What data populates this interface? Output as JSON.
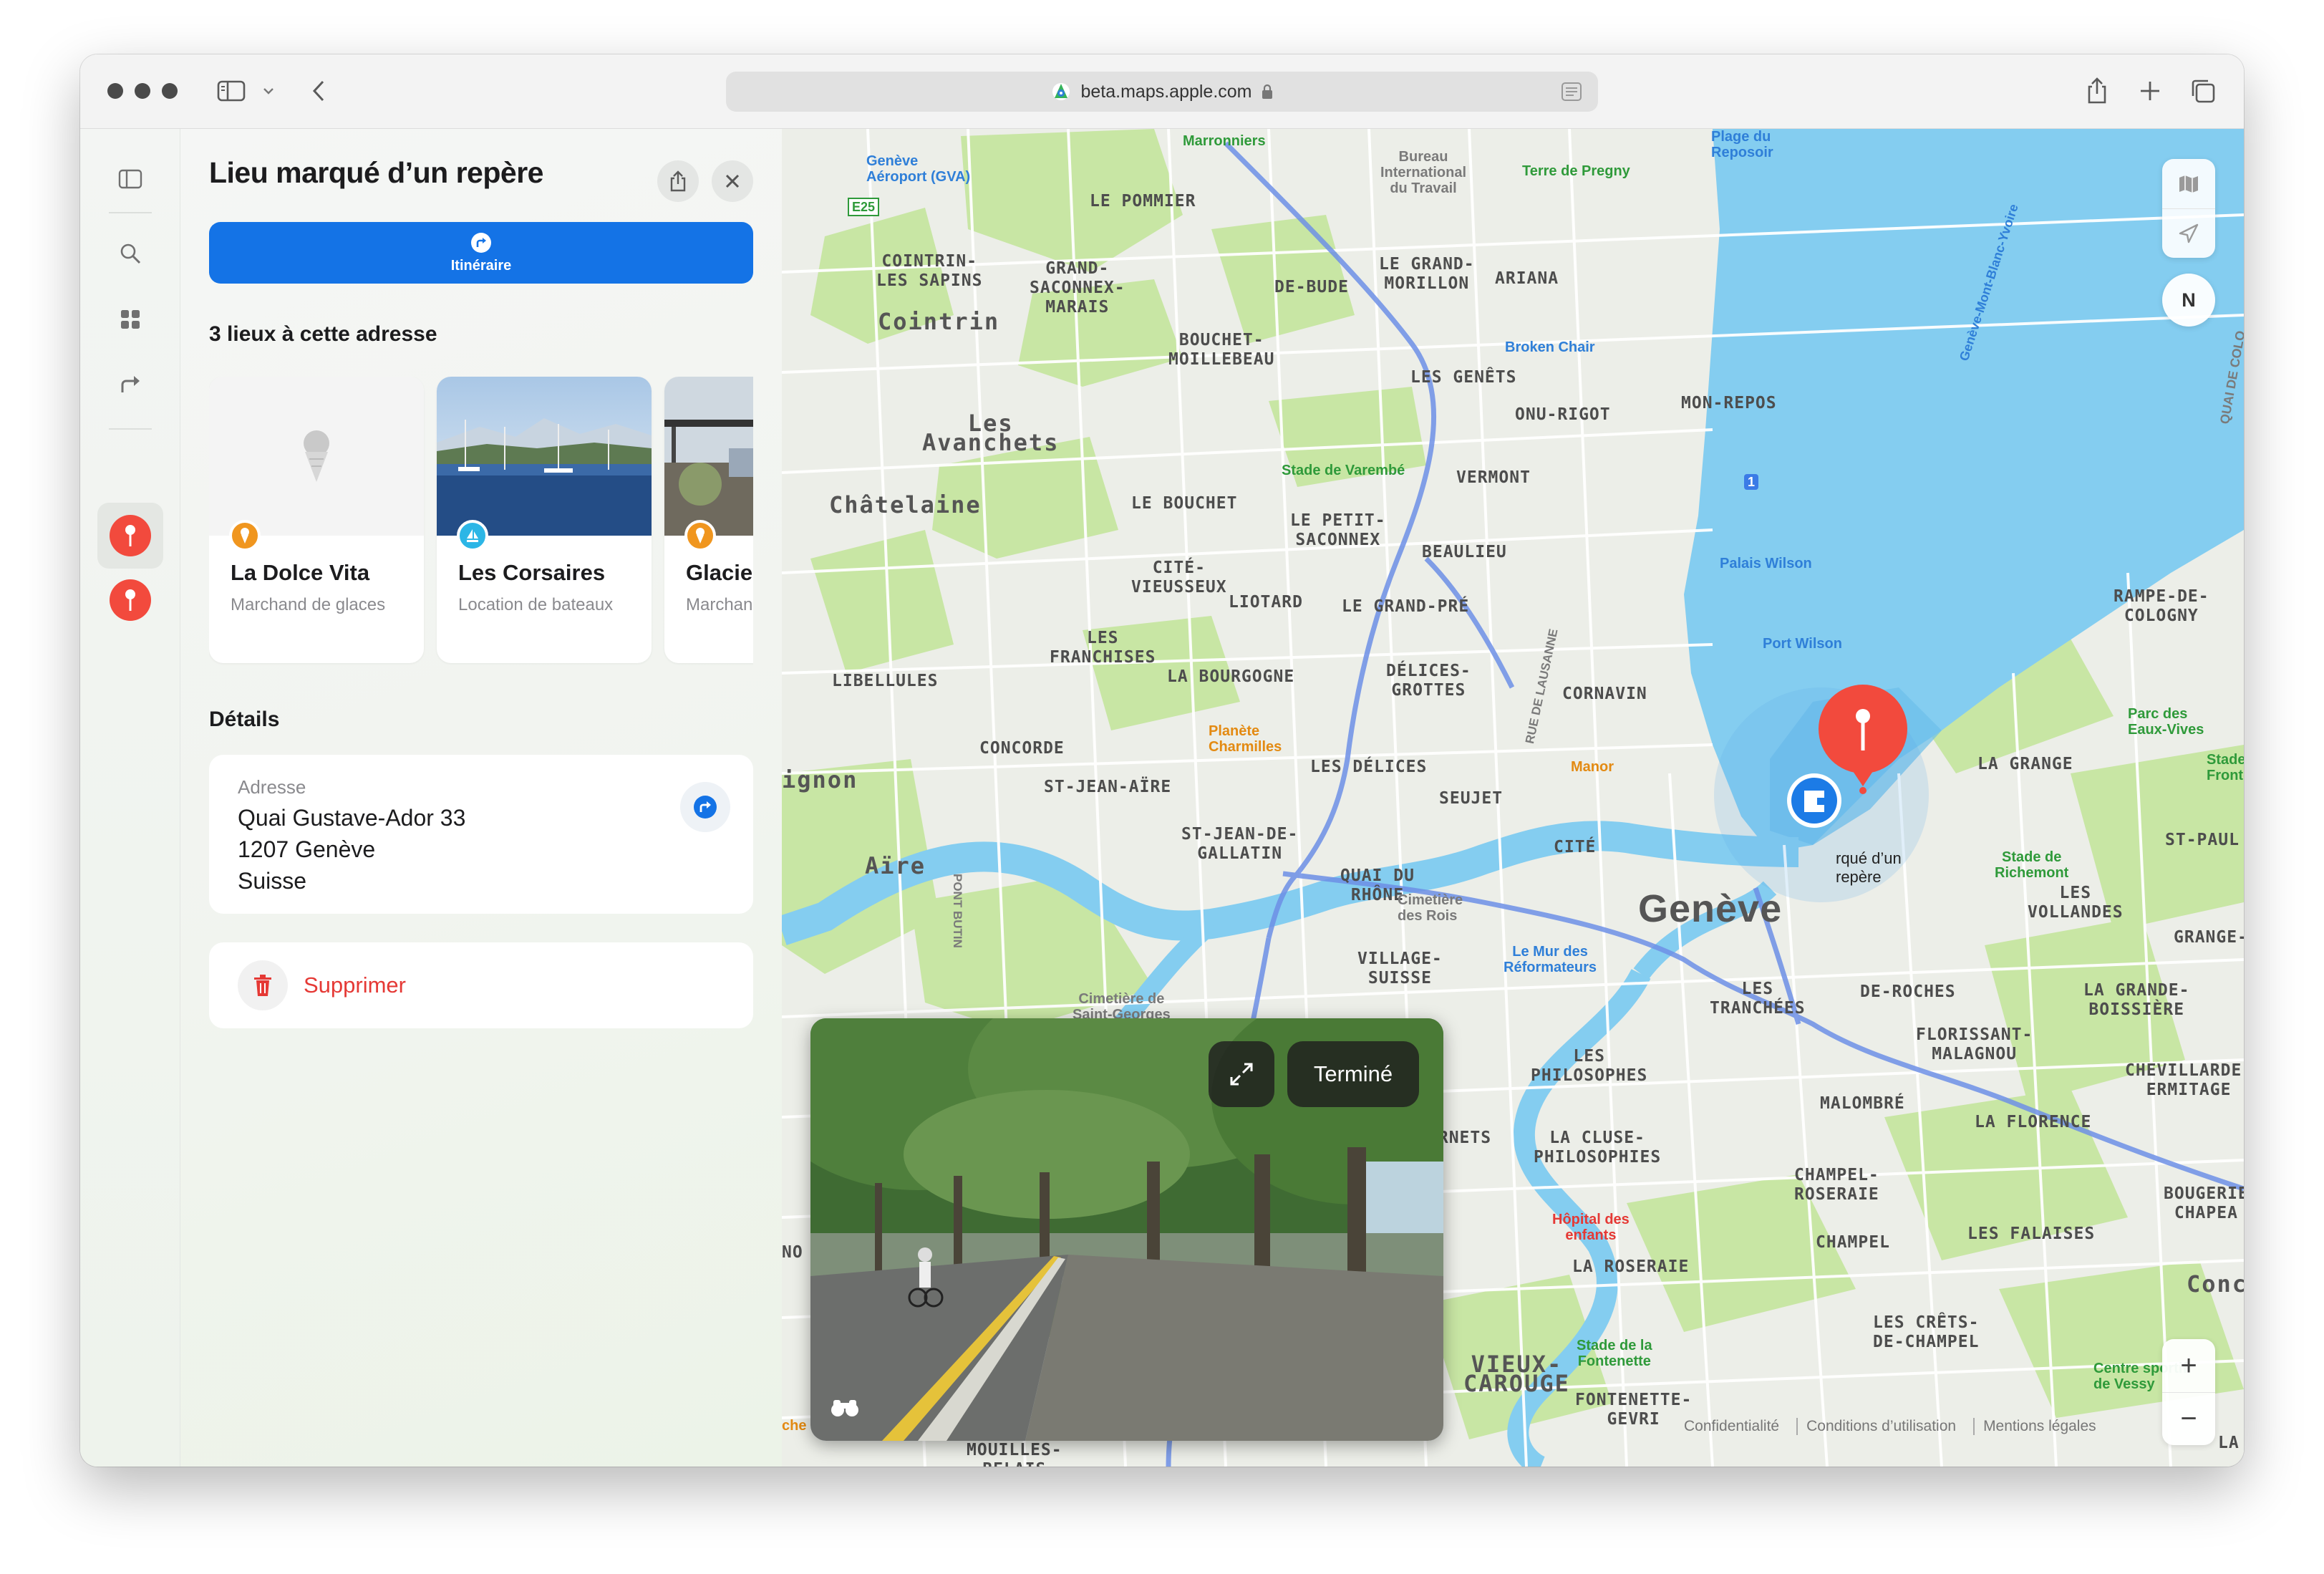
{
  "browser": {
    "url": "beta.maps.apple.com"
  },
  "panel": {
    "title": "Lieu marqué d’un repère",
    "route_label": "Itinéraire",
    "places_heading": "3 lieux à cette adresse",
    "places": [
      {
        "name": "La Dolce Vita",
        "type": "Marchand de glaces",
        "icon": "ice-cream-icon",
        "color": "#f0961f"
      },
      {
        "name": "Les Corsaires",
        "type": "Location de bateaux",
        "icon": "sailboat-icon",
        "color": "#2cb6e6"
      },
      {
        "name": "Glacie",
        "type": "Marchan glaces",
        "icon": "ice-cream-icon",
        "color": "#f0961f"
      }
    ],
    "details_heading": "Détails",
    "address_caption": "Adresse",
    "address_lines": [
      "Quai Gustave-Ador 33",
      "1207 Genève",
      "Suisse"
    ],
    "delete_label": "Supprimer"
  },
  "map": {
    "city": "Genève",
    "pin_label": "rqué d’un\nrepère",
    "compass": "N",
    "zoom_in": "+",
    "zoom_out": "−",
    "legal": [
      "Confidentialité",
      "Conditions d’utilisation",
      "Mentions légales"
    ],
    "districts": [
      "LE POMMIER",
      "COINTRIN-\nLES SAPINS",
      "GRAND-\nSACONNEX-\nMARAIS",
      "DE-BUDE",
      "LE GRAND-\nMORILLON",
      "ARIANA",
      "Cointrin",
      "BOUCHET-\nMOILLEBEAU",
      "LES GENÊTS",
      "ONU-RIGOT",
      "MON-REPOS",
      "Les\nAvanchets",
      "VERMONT",
      "Châtelaine",
      "LE BOUCHET",
      "LE PETIT-\nSACONNEX",
      "BEAULIEU",
      "CITÉ-\nVIEUSSEUX",
      "LIOTARD",
      "LE GRAND-PRÉ",
      "RAMPE-DE-\nCOLOGNY",
      "LES\nFRANCHISES",
      "LA BOURGOGNE",
      "DÉLICES-\nGROTTES",
      "LIBELLULES",
      "CORNAVIN",
      "CONCORDE",
      "LES DÉLICES",
      "LA GRANGE",
      "ignon",
      "ST-JEAN-AÏRE",
      "SEUJET",
      "ST-PAUL",
      "ST-JEAN-DE-\nGALLATIN",
      "CITÉ",
      "Aïre",
      "QUAI DU\nRHÔNE",
      "LES\nVOLLANDES",
      "GRANGE-",
      "VILLAGE-\nSUISSE",
      "LES\nTRANCHÉES",
      "DE-ROCHES",
      "LA GRANDE-\nBOISSIÈRE",
      "FLORISSANT-\nMALAGNOU",
      "CHEVILLARDE-\nERMITAGE",
      "LES\nPHILOSOPHES",
      "MALOMBRÉ",
      "LA FLORENCE",
      "ERNETS",
      "LA CLUSE-\nPHILOSOPHIES",
      "CHAMPEL-\nROSERAIE",
      "BOUGERIE\nCHAPEA",
      "LES FALAISES",
      "CHAMPEL",
      "LA ROSERAIE",
      "Conc",
      "LES CRÊTS-\nDE-CHAMPEL",
      "VIEUX-\nCAROUGE",
      "FONTENETTE-\nGEVRI",
      "MOUILLES-\nRELAIS",
      "NO",
      "LA"
    ],
    "pois": [
      {
        "text": "Marronniers",
        "style": "green"
      },
      {
        "text": "Genève\nAéroport (GVA)",
        "style": "blue"
      },
      {
        "text": "E25",
        "style": "green"
      },
      {
        "text": "Bureau\nInternational\ndu Travail",
        "style": "gray"
      },
      {
        "text": "Terre de Pregny",
        "style": "green"
      },
      {
        "text": "Plage du\nReposoir",
        "style": "blue"
      },
      {
        "text": "Broken Chair",
        "style": "blue"
      },
      {
        "text": "Stade de Varembé",
        "style": "green"
      },
      {
        "text": "Palais Wilson",
        "style": "blue"
      },
      {
        "text": "Port Wilson",
        "style": "blue"
      },
      {
        "text": "Genève-Mont-Blanc-Yvoire",
        "style": "blue"
      },
      {
        "text": "QUAI DE COLO",
        "style": "gray"
      },
      {
        "text": "Parc des\nEaux-Vives",
        "style": "green"
      },
      {
        "text": "Stade d\nFronten",
        "style": "green"
      },
      {
        "text": "Planète\nCharmilles",
        "style": "orange"
      },
      {
        "text": "Manor",
        "style": "orange"
      },
      {
        "text": "Stade de\nRichemont",
        "style": "green"
      },
      {
        "text": "Cimetière\ndes Rois",
        "style": "gray"
      },
      {
        "text": "Le Mur des\nRéformateurs",
        "style": "blue"
      },
      {
        "text": "Cimetière de\nSaint-Georges",
        "style": "gray"
      },
      {
        "text": "PONT BUTIN",
        "style": "gray"
      },
      {
        "text": "RUE DE LAUSANNE",
        "style": "gray"
      },
      {
        "text": "Hôpital des\nenfants",
        "style": "red"
      },
      {
        "text": "Stade de la\nFontenette",
        "style": "green"
      },
      {
        "text": "Centre sportif\nde Vessy",
        "style": "green"
      },
      {
        "text": "1",
        "style": "blue"
      },
      {
        "text": "che",
        "style": "orange"
      }
    ]
  },
  "lookaround": {
    "done_label": "Terminé"
  }
}
